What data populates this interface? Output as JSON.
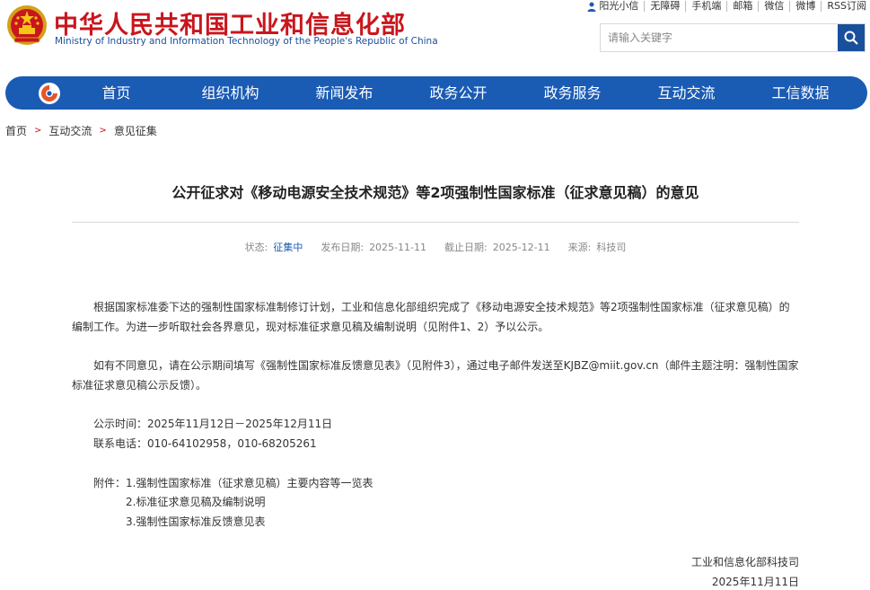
{
  "header": {
    "brand_cn": "中华人民共和国工业和信息化部",
    "brand_en": "Ministry of Industry and Information Technology of the People's Republic of China",
    "emblem_icon": "national-emblem-icon",
    "top_links": [
      "阳光小信",
      "无障碍",
      "手机端",
      "邮箱",
      "微信",
      "微博",
      "RSS订阅"
    ],
    "search_placeholder": "请输入关键字",
    "search_icon": "search-icon"
  },
  "nav": {
    "items": [
      "首页",
      "组织机构",
      "新闻发布",
      "政务公开",
      "政务服务",
      "互动交流",
      "工信数据"
    ],
    "color": "#1a5bb4"
  },
  "breadcrumb": {
    "items": [
      "首页",
      "互动交流",
      "意见征集"
    ],
    "separator": ">"
  },
  "article": {
    "title": "公开征求对《移动电源安全技术规范》等2项强制性国家标准（征求意见稿）的意见",
    "meta": {
      "status_label": "状态:",
      "status_value": "征集中",
      "publish_label": "发布日期:",
      "publish_value": "2025-11-11",
      "deadline_label": "截止日期:",
      "deadline_value": "2025-12-11",
      "source_label": "来源:",
      "source_value": "科技司"
    },
    "paragraph1": "根据国家标准委下达的强制性国家标准制修订计划，工业和信息化部组织完成了《移动电源安全技术规范》等2项强制性国家标准（征求意见稿）的编制工作。为进一步听取社会各界意见，现对标准征求意见稿及编制说明（见附件1、2）予以公示。",
    "paragraph2": "如有不同意见，请在公示期间填写《强制性国家标准反馈意见表》（见附件3），通过电子邮件发送至KJBZ@miit.gov.cn（邮件主题注明：强制性国家标准征求意见稿公示反馈）。",
    "period": "公示时间：2025年11月12日－2025年12月11日",
    "phone": "联系电话：010-64102958，010-68205261",
    "attachments_label": "附件：",
    "attachments": [
      "1.强制性国家标准（征求意见稿）主要内容等一览表",
      "2.标准征求意见稿及编制说明",
      "3.强制性国家标准反馈意见表"
    ],
    "sign_org": "工业和信息化部科技司",
    "sign_date": "2025年11月11日"
  }
}
